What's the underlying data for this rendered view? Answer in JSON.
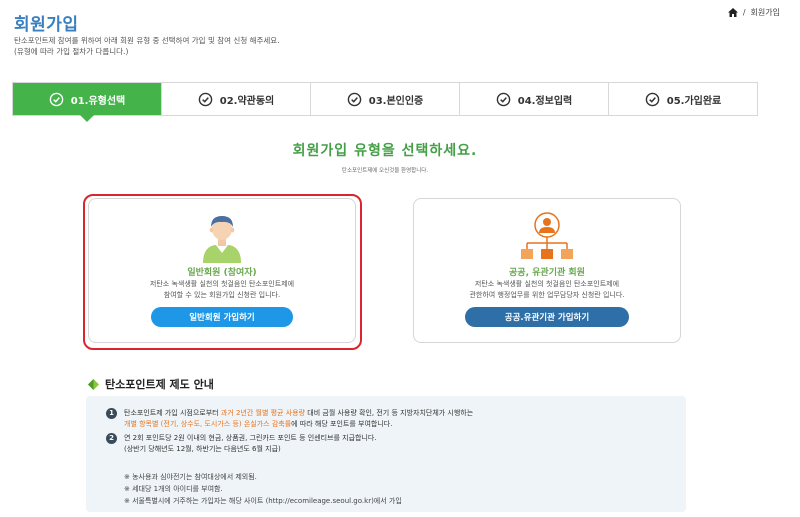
{
  "header": {
    "title": "회원가입",
    "desc_line1": "탄소포인트제 참여를 위하여 아래 회원 유형 중 선택하여 가입 및 참여 신청 해주세요.",
    "desc_line2": "(유형에 따라 가입 절차가 다릅니다.)"
  },
  "breadcrumb": {
    "separator": "/",
    "current": "회원가입",
    "home_icon": "home-icon"
  },
  "steps": [
    {
      "label": "01.유형선택",
      "active": true
    },
    {
      "label": "02.약관동의",
      "active": false
    },
    {
      "label": "03.본인인증",
      "active": false
    },
    {
      "label": "04.정보입력",
      "active": false
    },
    {
      "label": "05.가입완료",
      "active": false
    }
  ],
  "main": {
    "heading": "회원가입 유형을 선택하세요.",
    "subheading": "탄소포인트제에 오신것을 환영합니다."
  },
  "cards": {
    "general": {
      "title": "일반회원 (참여자)",
      "desc1": "저탄소 녹색생활 실천의 첫걸음인 탄소포인트제에",
      "desc2": "참여할 수 있는 회원가입 신청란 입니다.",
      "button": "일반회원 가입하기"
    },
    "public": {
      "title": "공공, 유관기관 회원",
      "desc1": "저탄소 녹색생활 실천의 첫걸음인 탄소포인트제에",
      "desc2": "관한하여 행정업무를 위한 업무담당자 신청란 입니다.",
      "button": "공공.유관기관 가입하기"
    }
  },
  "guide": {
    "heading": "탄소포인트제 제도 안내",
    "item1_a": "탄소포인트제 가입 시점으로부터 ",
    "item1_highlight": "과거 2년간 월별 평균 사용량",
    "item1_b": " 대비 금월 사용량 확인, 전기 등 지방자치단체가 시행하는",
    "item1_line2_highlight": "개별 항목별 (전기, 상수도, 도시가스 등) 온실가스 감축률",
    "item1_line2_b": "에 따라 해당 포인트를 부여합니다.",
    "item2_line1": "연 2회 포인트당 2원 이내의 현금, 상품권, 그린카드 포인트 등 인센티브를 지급합니다.",
    "item2_line2": "(상반기 당해년도 12월, 하반기는 다음년도 6월 지급)",
    "notes": [
      "※  농사용과 심야전기는 참여대상에서 제외됨.",
      "※  세대당 1개의 아이디를 부여함.",
      "※  서울특별시에 거주하는 가입자는 해당 사이트 (http://ecomileage.seoul.go.kr)에서 가입"
    ]
  },
  "colors": {
    "accent_green": "#43b34a",
    "title_blue": "#3a7fc1",
    "button_blue": "#1e97e6",
    "button_dark_blue": "#2e6fa8",
    "highlight_red": "#d9262c",
    "highlight_orange": "#e8731d"
  }
}
